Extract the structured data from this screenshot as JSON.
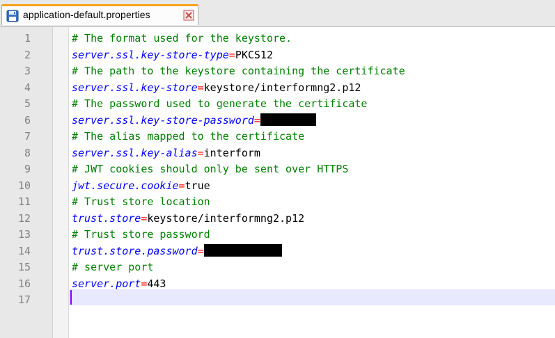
{
  "tab": {
    "title": "application-default.properties",
    "icon": "save-disk-icon",
    "close_icon": "close-icon"
  },
  "colors": {
    "comment": "#008000",
    "key": "#0000ff",
    "operator": "#ff0000",
    "value": "#000000",
    "active_line": "#e8e8ff",
    "tab_accent": "#f7a11a"
  },
  "lines": [
    {
      "no": "1",
      "comment": "# The format used for the keystore."
    },
    {
      "no": "2",
      "key": "server.ssl.key-store-type",
      "op": "=",
      "value": "PKCS12"
    },
    {
      "no": "3",
      "comment": "# The path to the keystore containing the certificate"
    },
    {
      "no": "4",
      "key": "server.ssl.key-store",
      "op": "=",
      "value": "keystore/interformng2.p12"
    },
    {
      "no": "5",
      "comment": "# The password used to generate the certificate"
    },
    {
      "no": "6",
      "key": "server.ssl.key-store-password",
      "op": "=",
      "value": "",
      "redacted": true
    },
    {
      "no": "7",
      "comment": "# The alias mapped to the certificate"
    },
    {
      "no": "8",
      "key": "server.ssl.key-alias",
      "op": "=",
      "value": "interform"
    },
    {
      "no": "9",
      "comment": "# JWT cookies should only be sent over HTTPS"
    },
    {
      "no": "10",
      "key": "jwt.secure.cookie",
      "op": "=",
      "value": "true"
    },
    {
      "no": "11",
      "comment": "# Trust store location"
    },
    {
      "no": "12",
      "key": "trust.store",
      "op": "=",
      "value": "keystore/interformng2.p12"
    },
    {
      "no": "13",
      "comment": "# Trust store password"
    },
    {
      "no": "14",
      "key": "trust.store.password",
      "op": "=",
      "value": "",
      "redacted": true
    },
    {
      "no": "15",
      "comment": "# server port"
    },
    {
      "no": "16",
      "key": "server.port",
      "op": "=",
      "value": "443"
    },
    {
      "no": "17",
      "active": true
    }
  ]
}
